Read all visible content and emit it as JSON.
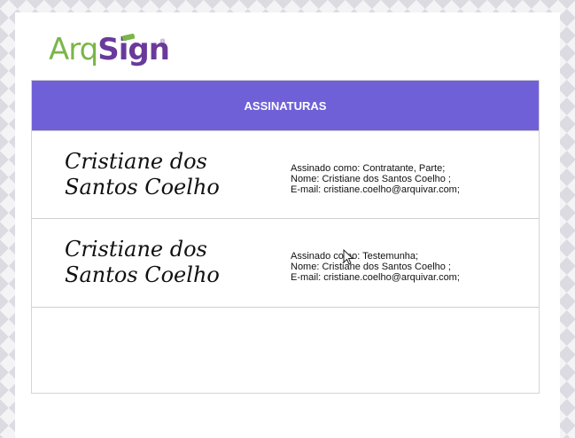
{
  "logo": {
    "part1": "Arq",
    "part2": "Sign",
    "trademark": "®"
  },
  "table": {
    "header": "ASSINATURAS"
  },
  "signatures": [
    {
      "name": "Cristiane dos Santos Coelho",
      "signed_as": "Assinado como: Contratante, Parte;",
      "name_line": "Nome: Cristiane dos Santos Coelho ;",
      "email_line": "E-mail: cristiane.coelho@arquivar.com;"
    },
    {
      "name": "Cristiane dos Santos Coelho",
      "signed_as": "Assinado como: Testemunha;",
      "name_line": "Nome: Cristiane dos Santos Coelho ;",
      "email_line": "E-mail: cristiane.coelho@arquivar.com;"
    }
  ],
  "colors": {
    "header_bg": "#6f60d8",
    "logo_green": "#7ab648",
    "logo_purple": "#6a3a9b"
  },
  "icons": {
    "cursor": "mouse-pointer-icon"
  }
}
